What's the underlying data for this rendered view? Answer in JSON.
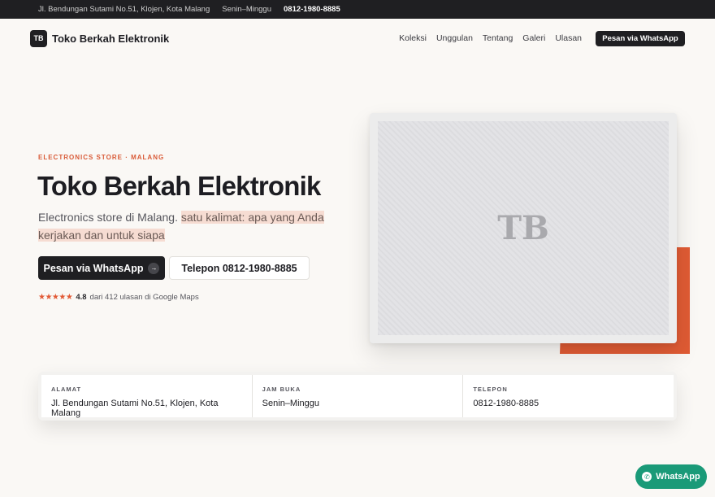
{
  "topbar": {
    "address": "Jl. Bendungan Sutami No.51, Klojen, Kota Malang",
    "hours": "Senin–Minggu",
    "phone": "0812-1980-8885"
  },
  "nav": {
    "logo_initials": "TB",
    "brand": "Toko Berkah Elektronik",
    "items": [
      "Koleksi",
      "Unggulan",
      "Tentang",
      "Galeri",
      "Ulasan"
    ],
    "cta": "Pesan via WhatsApp"
  },
  "hero": {
    "eyebrow": "ELECTRONICS STORE · MALANG",
    "title": "Toko Berkah Elektronik",
    "subtitle_plain": "Electronics store di Malang.",
    "subtitle_highlight": "satu kalimat: apa yang Anda kerjakan dan untuk siapa",
    "primary_cta": "Pesan via WhatsApp",
    "arrow": "→",
    "secondary_cta": "Telepon 0812-1980-8885",
    "stars": "★★★★★",
    "rating_score": "4.8",
    "rating_text": "dari 412 ulasan di Google Maps",
    "image_placeholder": "TB"
  },
  "info": {
    "cells": [
      {
        "label": "ALAMAT",
        "value": "Jl. Bendungan Sutami No.51, Klojen, Kota Malang"
      },
      {
        "label": "JAM BUKA",
        "value": "Senin–Minggu"
      },
      {
        "label": "TELEPON",
        "value": "0812-1980-8885"
      }
    ]
  },
  "floating": {
    "whatsapp_label": "WhatsApp"
  },
  "colors": {
    "accent": "#e05b34",
    "dark": "#1f1f22",
    "whatsapp": "#1a9a78",
    "background": "#faf8f5"
  }
}
